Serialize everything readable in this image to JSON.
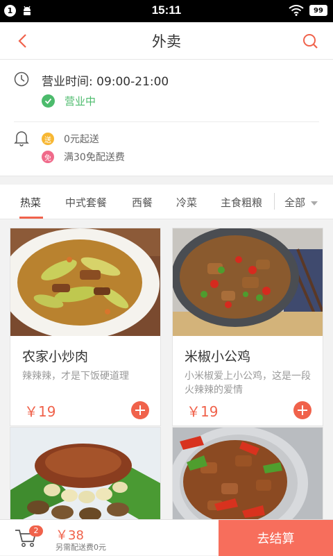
{
  "status_bar": {
    "badge": "1",
    "time": "15:11",
    "battery": "99"
  },
  "header": {
    "title": "外卖"
  },
  "shop_info": {
    "hours": "营业时间: 09:00-21:00",
    "status": "营业中",
    "promotions": [
      {
        "tag": "送",
        "text": "0元起送"
      },
      {
        "tag": "免",
        "text": "满30免配送费"
      }
    ]
  },
  "tabs": [
    "热菜",
    "中式套餐",
    "西餐",
    "冷菜",
    "主食粗粮"
  ],
  "tab_all": "全部",
  "dishes": [
    {
      "name": "农家小炒肉",
      "desc": "辣辣辣，才是下饭硬道理",
      "price": "￥19"
    },
    {
      "name": "米椒小公鸡",
      "desc": "小米椒爱上小公鸡，这是一段火辣辣的爱情",
      "price": "￥19"
    },
    {
      "name": "",
      "desc": "",
      "price": ""
    },
    {
      "name": "",
      "desc": "",
      "price": ""
    }
  ],
  "cart": {
    "count": "2",
    "total": "￥38",
    "fee_note": "另需配送费0元",
    "checkout": "去结算"
  },
  "colors": {
    "accent": "#f0624b",
    "open_green": "#4cbb6c",
    "checkout_bg": "#f76e5c"
  }
}
